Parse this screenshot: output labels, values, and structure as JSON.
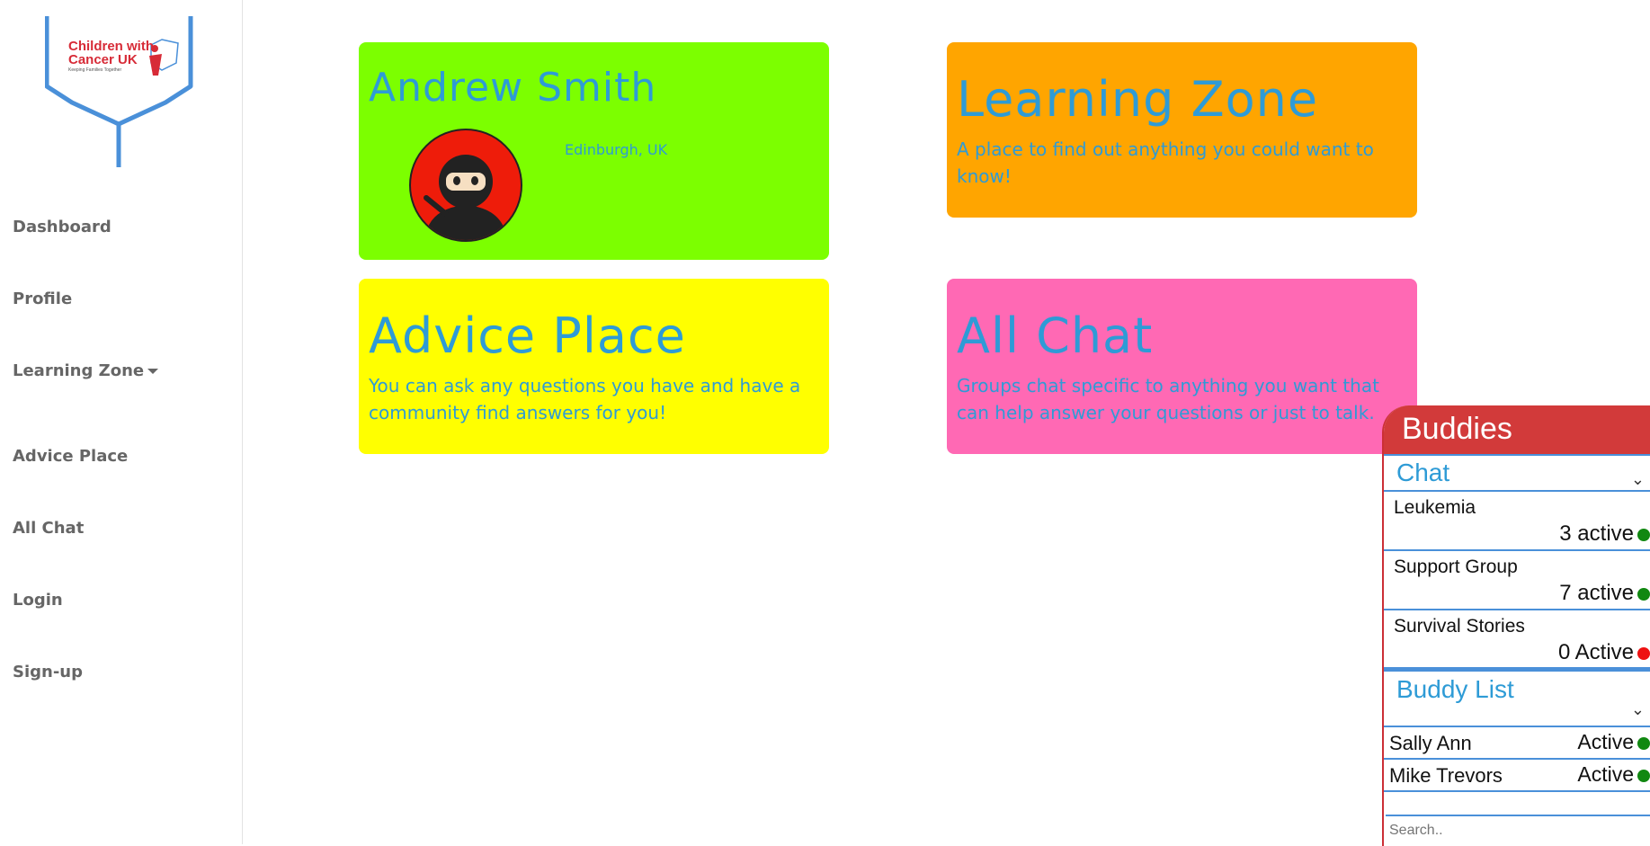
{
  "sidebar": {
    "logo": {
      "line1": "Children with",
      "line2": "Cancer UK",
      "tagline": "Keeping Families Together"
    },
    "items": [
      {
        "label": "Dashboard"
      },
      {
        "label": "Profile"
      },
      {
        "label": "Learning Zone"
      },
      {
        "label": "Advice Place"
      },
      {
        "label": "All Chat"
      },
      {
        "label": "Login"
      },
      {
        "label": "Sign-up"
      }
    ]
  },
  "cards": {
    "profile": {
      "name": "Andrew Smith",
      "location": "Edinburgh, UK",
      "color": "#7cff00"
    },
    "learning": {
      "title": "Learning Zone",
      "desc": "A place to find out anything you could want to know!",
      "color": "#ffa500"
    },
    "advice": {
      "title": "Advice Place",
      "desc": "You can ask any questions you have and have a community find answers for you!",
      "color": "#ffff00"
    },
    "chat": {
      "title": "All Chat",
      "desc": "Groups chat specific to anything you want that can help answer your questions or just to talk.",
      "color": "#ff69b4"
    }
  },
  "buddies": {
    "title": "Buddies",
    "chat_label": "Chat",
    "chats": [
      {
        "name": "Leukemia",
        "count": "3 active",
        "status_color": "#118811"
      },
      {
        "name": "Support Group",
        "count": "7 active",
        "status_color": "#118811"
      },
      {
        "name": "Survival Stories",
        "count": "0 Active",
        "status_color": "#ee1111"
      }
    ],
    "buddy_list_label": "Buddy List",
    "buddy_list": [
      {
        "name": "Sally Ann",
        "status": "Active",
        "status_color": "#118811"
      },
      {
        "name": "Mike Trevors",
        "status": "Active",
        "status_color": "#118811"
      }
    ],
    "search_placeholder": "Search.."
  },
  "colors": {
    "accent_text": "#2e9bd6",
    "nav_text": "#666666",
    "buddies_header": "#d23a3a",
    "divider": "#4a90d9"
  }
}
